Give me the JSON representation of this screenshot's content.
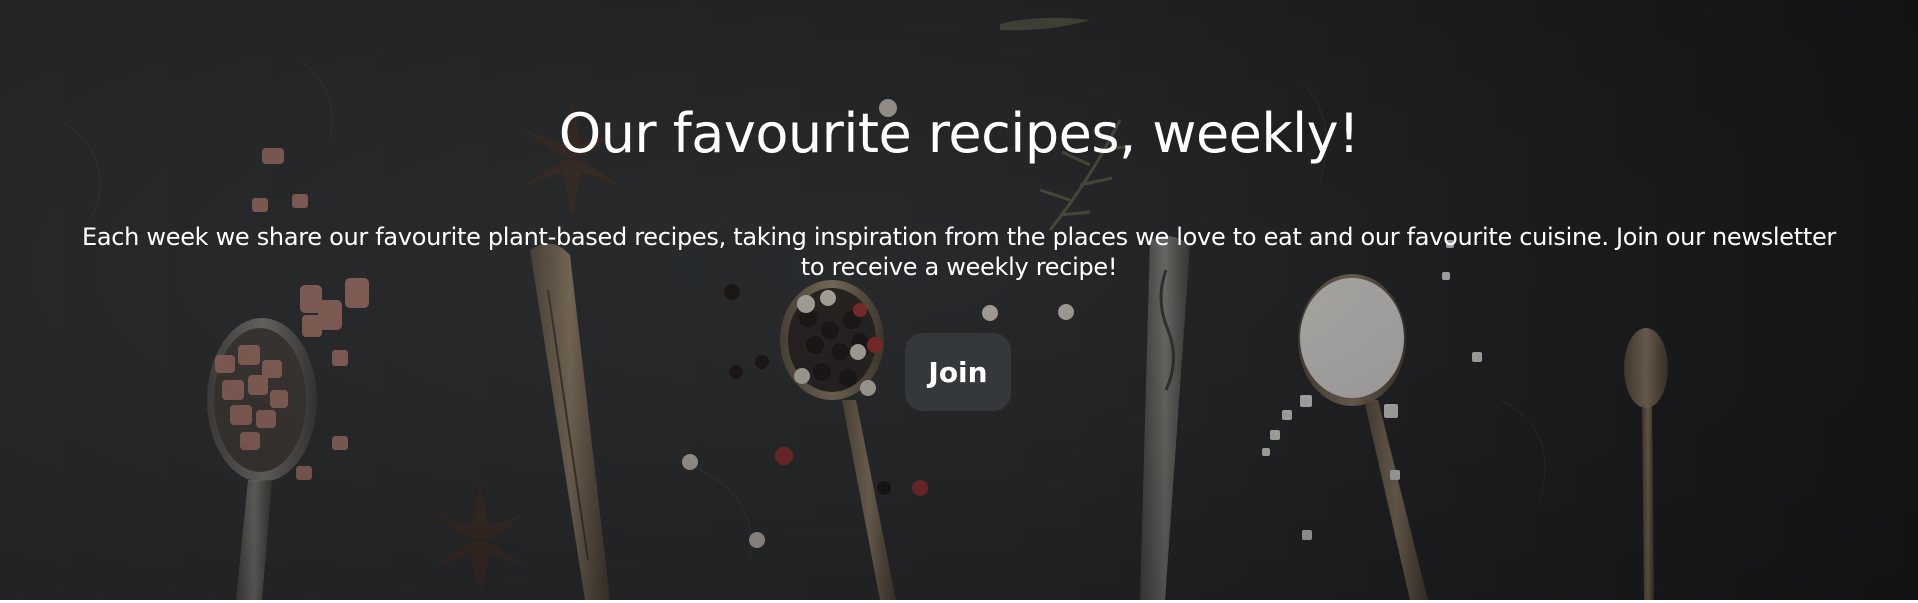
{
  "hero": {
    "title": "Our favourite recipes, weekly!",
    "subtitle": "Each week we share our favourite plant-based recipes, taking inspiration from the places we love to eat and our favourite cuisine. Join our newsletter to receive a weekly recipe!",
    "join_label": "Join"
  },
  "colors": {
    "overlay": "#2a2c2f",
    "button": "#34383b",
    "text": "#ffffff"
  },
  "icons": [
    "spoon-icon",
    "star-anise-icon",
    "peppercorn-icon",
    "salt-crystal-icon"
  ]
}
